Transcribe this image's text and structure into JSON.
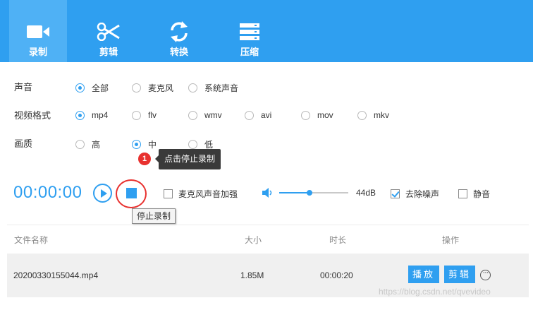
{
  "toolbar": {
    "tabs": [
      {
        "label": "录制",
        "icon": "video-camera-icon",
        "active": true
      },
      {
        "label": "剪辑",
        "icon": "scissors-icon",
        "active": false
      },
      {
        "label": "转换",
        "icon": "convert-icon",
        "active": false
      },
      {
        "label": "压缩",
        "icon": "compress-icon",
        "active": false
      }
    ]
  },
  "options": {
    "sound": {
      "label": "声音",
      "choices": [
        "全部",
        "麦克风",
        "系统声音"
      ],
      "selected": "全部"
    },
    "format": {
      "label": "视频格式",
      "choices": [
        "mp4",
        "flv",
        "wmv",
        "avi",
        "mov",
        "mkv"
      ],
      "selected": "mp4"
    },
    "quality": {
      "label": "画质",
      "choices": [
        "高",
        "中",
        "低"
      ],
      "selected": "中"
    }
  },
  "hint": {
    "badge": "1",
    "text": "点击停止录制"
  },
  "controls": {
    "timer": "00:00:00",
    "stop_tooltip": "停止录制",
    "mic_boost": {
      "label": "麦克风声音加强",
      "checked": false
    },
    "volume": {
      "level": 0.44,
      "label": "44dB"
    },
    "denoise": {
      "label": "去除噪声",
      "checked": true
    },
    "mute": {
      "label": "静音",
      "checked": false
    }
  },
  "table": {
    "headers": {
      "name": "文件名称",
      "size": "大小",
      "duration": "时长",
      "action": "操作"
    },
    "rows": [
      {
        "name": "20200330155044.mp4",
        "size": "1.85M",
        "duration": "00:00:20",
        "play_label": "播放",
        "edit_label": "剪辑"
      }
    ]
  },
  "watermark": "https://blog.csdn.net/qvevideo",
  "colors": {
    "accent": "#2f9ff0",
    "highlight": "#e8312f",
    "toolbar_active": "#4fb1f5"
  }
}
